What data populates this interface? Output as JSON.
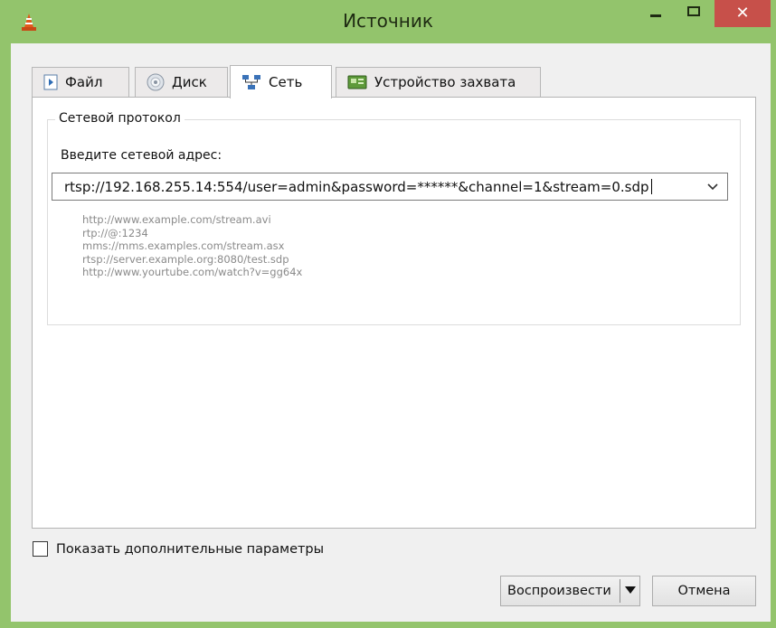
{
  "window": {
    "title": "Источник",
    "close_symbol": "✕"
  },
  "tabs": [
    {
      "label": "Файл",
      "icon": "file-play-icon",
      "active": false
    },
    {
      "label": "Диск",
      "icon": "disc-icon",
      "active": false
    },
    {
      "label": "Сеть",
      "icon": "network-icon",
      "active": true
    },
    {
      "label": "Устройство захвата",
      "icon": "capture-device-icon",
      "active": false
    }
  ],
  "network": {
    "group_title": "Сетевой протокол",
    "address_label": "Введите сетевой адрес:",
    "address_value": "rtsp://192.168.255.14:554/user=admin&password=******&channel=1&stream=0.sdp",
    "examples": [
      "http://www.example.com/stream.avi",
      "rtp://@:1234",
      "mms://mms.examples.com/stream.asx",
      "rtsp://server.example.org:8080/test.sdp",
      "http://www.yourtube.com/watch?v=gg64x"
    ]
  },
  "options": {
    "show_more_label": "Показать дополнительные параметры",
    "show_more_checked": false
  },
  "buttons": {
    "play_label": "Воспроизвести",
    "cancel_label": "Отмена"
  },
  "colors": {
    "titlebar": "#93c46c",
    "close_button": "#c7504a"
  }
}
